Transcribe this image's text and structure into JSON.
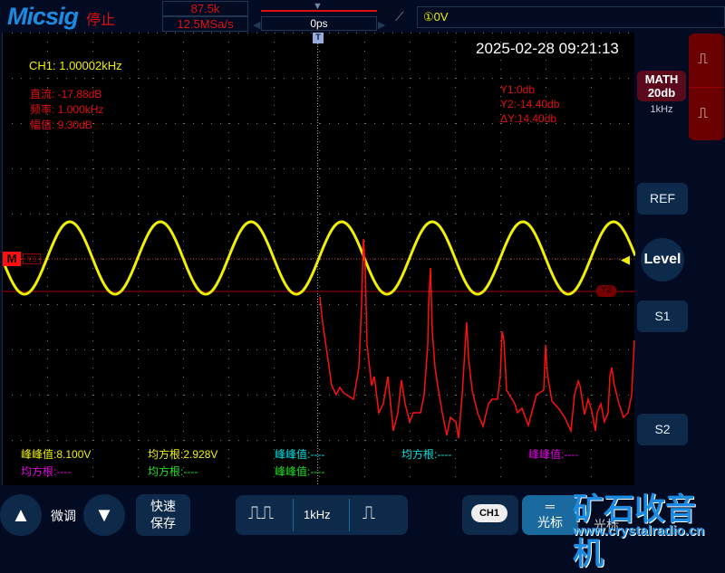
{
  "header": {
    "logo": "Micsig",
    "status": "停止",
    "sample_points": "87.5k",
    "sample_rate": "12.5MSa/s",
    "time_offset": "0ps",
    "trigger_level": "①0V"
  },
  "screen": {
    "timestamp": "2025-02-28 09:21:13",
    "ch1_freq": "CH1: 1.00002kHz",
    "fft": {
      "dc": "直流: -17.88dB",
      "freq": "频率: 1.000kHz",
      "amp": "幅值: 9.30dB"
    },
    "cursor": {
      "y1": "Y1:0db",
      "y2": "Y2:-14.40db",
      "dy": "ΔY:14.40db"
    },
    "markers": {
      "math": "M",
      "y1": "Y1",
      "y2": "Y2",
      "trigger": "T"
    },
    "measurements": [
      {
        "label": "峰峰值:8.100V",
        "color": "#f0f000"
      },
      {
        "label": "均方根:2.928V",
        "color": "#f0f000"
      },
      {
        "label": "峰峰值:----",
        "color": "#00e0e0"
      },
      {
        "label": "均方根:----",
        "color": "#00e0e0"
      },
      {
        "label": "峰峰值:----",
        "color": "#e000e0"
      },
      {
        "label": "均方根:----",
        "color": "#e000e0"
      },
      {
        "label": "均方根:----",
        "color": "#20e020"
      },
      {
        "label": "峰峰值:----",
        "color": "#20e020"
      }
    ]
  },
  "right_panel": {
    "math_label": "MATH",
    "math_scale": "20db",
    "math_freq": "1kHz",
    "ref": "REF",
    "level": "Level",
    "s1": "S1",
    "s2": "S2"
  },
  "bottom": {
    "fine_tune": "微调",
    "quick_save_1": "快速",
    "quick_save_2": "保存",
    "freq": "1kHz",
    "ch1": "CH1",
    "cursor": "光标",
    "cursor2": "光标",
    "watermark": "矿石收音机",
    "watermark_url": "www.crystalradio.cn"
  },
  "colors": {
    "ch1": "#f0f000",
    "math": "#ff1010",
    "accent": "#1a8be0"
  }
}
